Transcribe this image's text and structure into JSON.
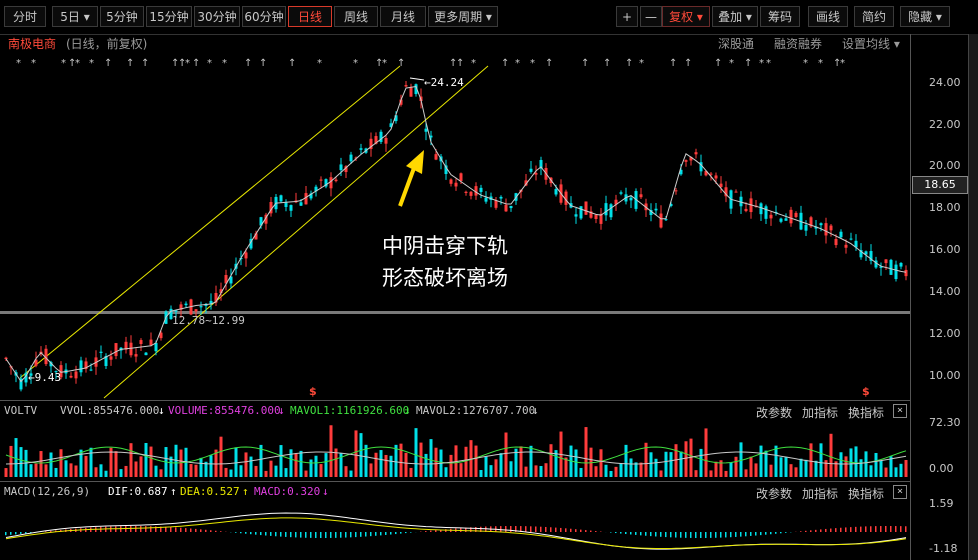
{
  "toolbar": {
    "periods": [
      "分时",
      "5日 ▾",
      "5分钟",
      "15分钟",
      "30分钟",
      "60分钟",
      "日线",
      "周线",
      "月线",
      "更多周期 ▾"
    ],
    "active_period": "日线",
    "plus_label": "+",
    "minus_label": "—",
    "right_items": [
      "复权 ▾",
      "叠加 ▾",
      "筹码",
      "画线",
      "简约",
      "隐藏 ▾"
    ]
  },
  "stock": {
    "name": "南极电商",
    "mode": "(日线，前复权)"
  },
  "sub_links": [
    "深股通",
    "融资融券",
    "设置均线 ▾"
  ],
  "y_axis": {
    "labels": [
      "24.00",
      "22.00",
      "20.00",
      "18.00",
      "16.00",
      "14.00",
      "12.00",
      "10.00"
    ],
    "current_price": "18.65"
  },
  "annotations": {
    "high_label": "24.24",
    "low_label": "9.43",
    "level_label": "12.78~12.99",
    "text_line1": "中阴击穿下轨",
    "text_line2": "形态破坏离场",
    "dividend_mark": "$"
  },
  "volume_panel": {
    "name": "VOLTV",
    "vvol": "VVOL:855476.000",
    "volume": "VOLUME:855476.000",
    "mavol1": "MAVOL1:1161926.600",
    "mavol2": "MAVOL2:1276707.700",
    "axis_top": "72.30",
    "axis_bottom": "0.00",
    "btn_params": "改参数",
    "btn_add": "加指标",
    "btn_switch": "换指标",
    "close": "×"
  },
  "macd_panel": {
    "name": "MACD(12,26,9)",
    "dif": "DIF:0.687",
    "dea": "DEA:0.527",
    "macd": "MACD:0.320",
    "axis_top": "1.59",
    "axis_bottom": "-1.18",
    "btn_params": "改参数",
    "btn_add": "加指标",
    "btn_switch": "换指标",
    "close": "×"
  },
  "colors": {
    "up": "#ff3c3c",
    "down": "#00e0e8",
    "channel": "#e8e800",
    "accent": "#ff4a3a"
  }
}
